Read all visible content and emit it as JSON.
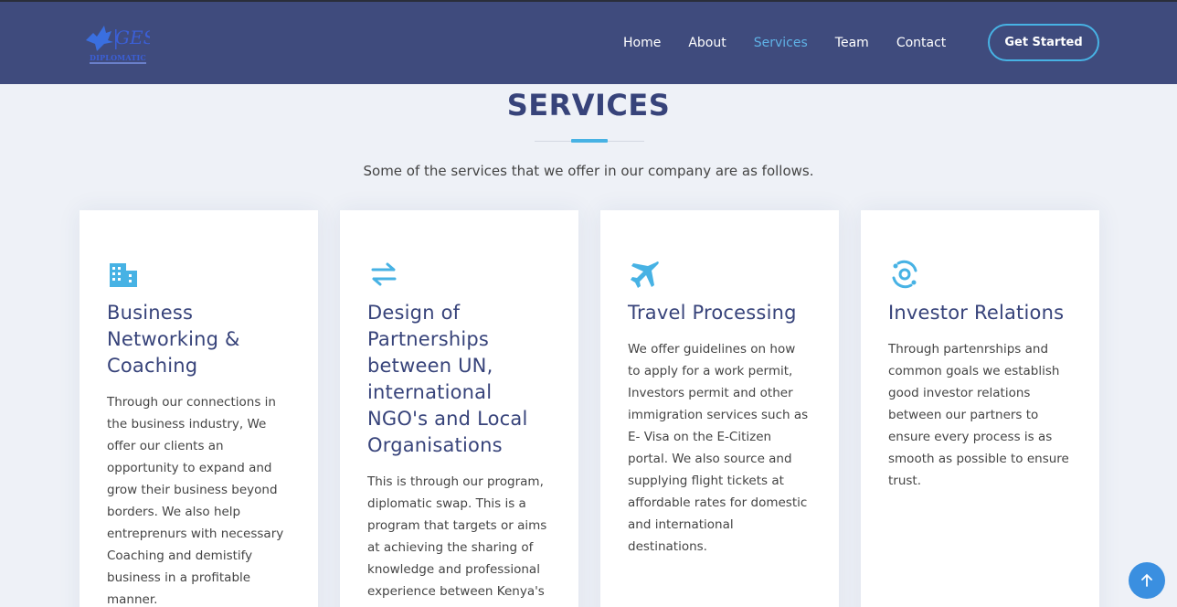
{
  "header": {
    "logo_text": "DIPLOMATIC",
    "nav": [
      "Home",
      "About",
      "Services",
      "Team",
      "Contact"
    ],
    "active_nav": "Services",
    "cta_label": "Get Started"
  },
  "section": {
    "title": "SERVICES",
    "subtitle": "Some of the services that we offer in our company are as follows."
  },
  "cards": [
    {
      "icon": "building-icon",
      "title": "Business Networking & Coaching",
      "text": "Through our connections in the business industry, We offer our clients an opportunity to expand and grow their business beyond borders. We also help entreprenurs with necessary Coaching and demistify business in a profitable manner."
    },
    {
      "icon": "swap-arrows-icon",
      "title": "Design of Partnerships between UN, international NGO's and Local Organisations",
      "text": "This is through our program, diplomatic swap. This is a program that targets or aims at achieving the sharing of knowledge and professional experience between Kenya's"
    },
    {
      "icon": "airplane-icon",
      "title": "Travel Processing",
      "text": "We offer guidelines on how to apply for a work permit, Investors permit and other immigration services such as E- Visa on the E-Citizen portal. We also source and supplying flight tickets at affordable rates for domestic and international destinations."
    },
    {
      "icon": "orbit-icon",
      "title": "Investor Relations",
      "text": "Through partenrships and common goals we establish good investor relations between our partners to ensure every process is as smooth as possible to ensure trust."
    }
  ],
  "colors": {
    "header_bg": "#3f4b7d",
    "accent": "#47b2e4",
    "title": "#37437a",
    "page_bg": "#eef1f7"
  },
  "back_to_top_icon": "arrow-up-icon"
}
